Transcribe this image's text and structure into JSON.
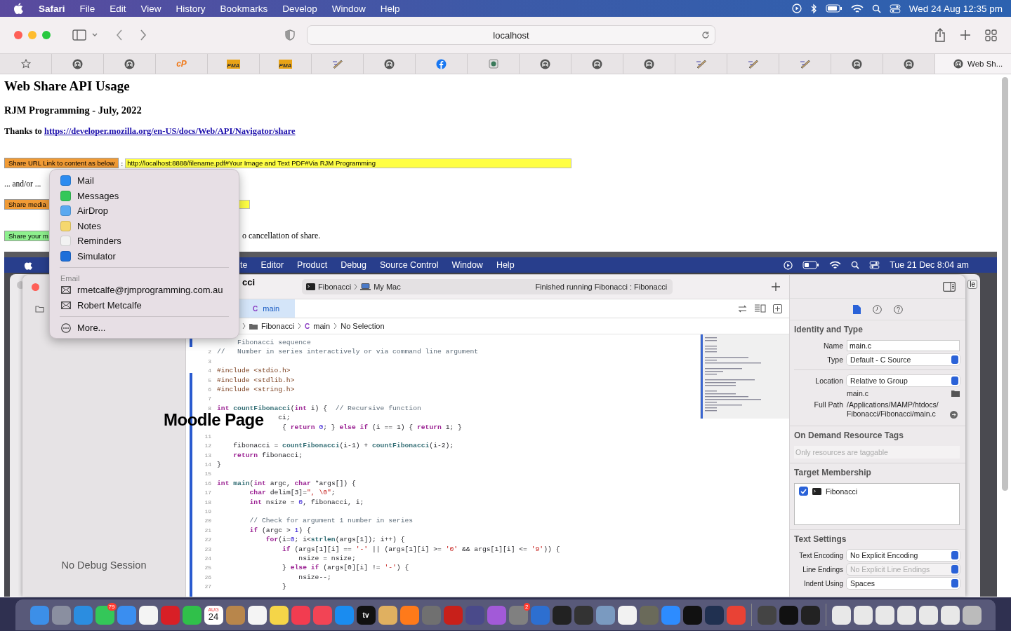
{
  "menu_bar": {
    "app": "Safari",
    "items": [
      "File",
      "Edit",
      "View",
      "History",
      "Bookmarks",
      "Develop",
      "Window",
      "Help"
    ],
    "clock": "Wed 24 Aug  12:35 pm"
  },
  "toolbar": {
    "address": "localhost"
  },
  "favorites_bar": {
    "icons": [
      {
        "kind": "elephant"
      },
      {
        "kind": "elephant"
      },
      {
        "kind": "text",
        "label": "cP"
      },
      {
        "kind": "pma",
        "label": "PMA"
      },
      {
        "kind": "pma",
        "label": "PMA"
      },
      {
        "kind": "pencil"
      },
      {
        "kind": "elephant"
      },
      {
        "kind": "facebook"
      },
      {
        "kind": "globe"
      },
      {
        "kind": "elephant"
      },
      {
        "kind": "elephant"
      },
      {
        "kind": "elephant"
      },
      {
        "kind": "pencil"
      },
      {
        "kind": "pencil"
      },
      {
        "kind": "pencil"
      },
      {
        "kind": "elephant"
      },
      {
        "kind": "elephant"
      }
    ],
    "tab_label": "Web Sh..."
  },
  "page": {
    "title": "Web Share API Usage",
    "subtitle": "RJM Programming - July, 2022",
    "thanks": "Thanks to",
    "link": "https://developer.mozilla.org/en-US/docs/Web/API/Navigator/share",
    "share_url": {
      "button": "Share URL Link to content as below",
      "separator": ":",
      "value": "http://localhost:8888/filename.pdf#Your Image and Text PDF#Via RJM Programming"
    },
    "and_or": "... and/or ...",
    "share_media": {
      "button": "Share media"
    },
    "share_your": {
      "button": "Share your m",
      "note": "o cancellation of share."
    }
  },
  "share_menu": {
    "apps": [
      {
        "kind": "mail",
        "label": "Mail"
      },
      {
        "kind": "messages",
        "label": "Messages"
      },
      {
        "kind": "airdrop",
        "label": "AirDrop"
      },
      {
        "kind": "notes",
        "label": "Notes"
      },
      {
        "kind": "reminders",
        "label": "Reminders"
      },
      {
        "kind": "simulator",
        "label": "Simulator"
      }
    ],
    "section": "Email",
    "contacts": [
      "rmetcalfe@rjmprogramming.com.au",
      "Robert Metcalfe"
    ],
    "more": "More..."
  },
  "screenshot": {
    "menu_bar": {
      "items": [
        "te",
        "Editor",
        "Product",
        "Debug",
        "Source Control",
        "Window",
        "Help"
      ],
      "clock": "Tue 21 Dec  8:04 am"
    },
    "behind_button": "le",
    "window_title": "cci",
    "scheme": {
      "target": "Fibonacci",
      "destination": "My Mac",
      "status": "Finished running Fibonacci : Fibonacci"
    },
    "tabs": [
      {
        "icon": "C",
        "label": "main",
        "selected": true
      }
    ],
    "jump_bar": [
      {
        "kind": "folder",
        "label": "Fibonacci"
      },
      {
        "kind": "c",
        "icon": "C",
        "label": "main"
      },
      {
        "kind": "plain",
        "label": "No Selection"
      }
    ],
    "navigator": {
      "status": "No Debug Session"
    },
    "overlay_text": "Moodle Page",
    "code": [
      {
        "seg": [
          {
            "kind": "comment",
            "text": "     Fibonacci sequence"
          }
        ]
      },
      {
        "n": "2",
        "seg": [
          {
            "kind": "comment",
            "text": "//   Number in series interactively or via command line argument"
          }
        ]
      },
      {
        "n": "3"
      },
      {
        "n": "4",
        "seg": [
          {
            "kind": "directive",
            "text": "#include <stdio.h>"
          }
        ]
      },
      {
        "n": "5",
        "seg": [
          {
            "kind": "directive",
            "text": "#include <stdlib.h>"
          }
        ]
      },
      {
        "n": "6",
        "seg": [
          {
            "kind": "directive",
            "text": "#include <string.h>"
          }
        ]
      },
      {
        "n": "7"
      },
      {
        "n": "8",
        "seg": [
          {
            "kind": "keyword",
            "text": "int"
          },
          {
            "kind": "function",
            "text": " countFibonacci"
          },
          {
            "kind": "plain",
            "text": "("
          },
          {
            "kind": "keyword",
            "text": "int"
          },
          {
            "kind": "plain",
            "text": " i) {  "
          },
          {
            "kind": "comment",
            "text": "// Recursive function"
          }
        ]
      },
      {
        "seg": [
          {
            "kind": "plain",
            "text": "               ci;"
          }
        ]
      },
      {
        "seg": [
          {
            "kind": "plain",
            "text": "                { "
          },
          {
            "kind": "keyword",
            "text": "return"
          },
          {
            "kind": "number",
            "text": " 0"
          },
          {
            "kind": "plain",
            "text": "; } "
          },
          {
            "kind": "keyword",
            "text": "else if"
          },
          {
            "kind": "plain",
            "text": " (i == 1) { "
          },
          {
            "kind": "keyword",
            "text": "return"
          },
          {
            "kind": "plain",
            "text": " 1; }"
          }
        ]
      },
      {
        "n": "11"
      },
      {
        "n": "12",
        "seg": [
          {
            "kind": "plain",
            "text": "    fibonacci = "
          },
          {
            "kind": "function",
            "text": "countFibonacci"
          },
          {
            "kind": "plain",
            "text": "(i-1) + "
          },
          {
            "kind": "function",
            "text": "countFibonacci"
          },
          {
            "kind": "plain",
            "text": "(i-2);"
          }
        ]
      },
      {
        "n": "13",
        "seg": [
          {
            "kind": "keyword",
            "text": "    return"
          },
          {
            "kind": "plain",
            "text": " fibonacci;"
          }
        ]
      },
      {
        "n": "14",
        "seg": [
          {
            "kind": "plain",
            "text": "}"
          }
        ]
      },
      {
        "n": "15"
      },
      {
        "n": "16",
        "seg": [
          {
            "kind": "keyword",
            "text": "int"
          },
          {
            "kind": "function",
            "text": " main"
          },
          {
            "kind": "plain",
            "text": "("
          },
          {
            "kind": "keyword",
            "text": "int"
          },
          {
            "kind": "plain",
            "text": " argc, "
          },
          {
            "kind": "keyword",
            "text": "char"
          },
          {
            "kind": "plain",
            "text": " *args[]) {"
          }
        ]
      },
      {
        "n": "17",
        "seg": [
          {
            "kind": "keyword",
            "text": "        char"
          },
          {
            "kind": "plain",
            "text": " delim[3]="
          },
          {
            "kind": "string",
            "text": "\", \\0\""
          },
          {
            "kind": "plain",
            "text": ";"
          }
        ]
      },
      {
        "n": "18",
        "seg": [
          {
            "kind": "keyword",
            "text": "        int"
          },
          {
            "kind": "plain",
            "text": " nsize = "
          },
          {
            "kind": "number",
            "text": "0"
          },
          {
            "kind": "plain",
            "text": ", fibonacci, i;"
          }
        ]
      },
      {
        "n": "19"
      },
      {
        "n": "20",
        "seg": [
          {
            "kind": "comment",
            "text": "        // Check for argument 1 number in series"
          }
        ]
      },
      {
        "n": "21",
        "seg": [
          {
            "kind": "keyword",
            "text": "        if"
          },
          {
            "kind": "plain",
            "text": " (argc > "
          },
          {
            "kind": "number",
            "text": "1"
          },
          {
            "kind": "plain",
            "text": ") {"
          }
        ]
      },
      {
        "n": "22",
        "seg": [
          {
            "kind": "keyword",
            "text": "            for"
          },
          {
            "kind": "plain",
            "text": "(i="
          },
          {
            "kind": "number",
            "text": "0"
          },
          {
            "kind": "plain",
            "text": "; i<"
          },
          {
            "kind": "function",
            "text": "strlen"
          },
          {
            "kind": "plain",
            "text": "(args[1]); i++) {"
          }
        ]
      },
      {
        "n": "23",
        "seg": [
          {
            "kind": "keyword",
            "text": "                if"
          },
          {
            "kind": "plain",
            "text": " (args[1][i] == "
          },
          {
            "kind": "string",
            "text": "'-'"
          },
          {
            "kind": "plain",
            "text": " || (args[1][i] >= "
          },
          {
            "kind": "string",
            "text": "'0'"
          },
          {
            "kind": "plain",
            "text": " && args[1][i] <= "
          },
          {
            "kind": "string",
            "text": "'9'"
          },
          {
            "kind": "plain",
            "text": ")) {"
          }
        ]
      },
      {
        "n": "24",
        "seg": [
          {
            "kind": "plain",
            "text": "                    nsize = nsize;"
          }
        ]
      },
      {
        "n": "25",
        "seg": [
          {
            "kind": "plain",
            "text": "                } "
          },
          {
            "kind": "keyword",
            "text": "else if"
          },
          {
            "kind": "plain",
            "text": " (args[0][i] != "
          },
          {
            "kind": "string",
            "text": "'-'"
          },
          {
            "kind": "plain",
            "text": ") {"
          }
        ]
      },
      {
        "n": "26",
        "seg": [
          {
            "kind": "plain",
            "text": "                    nsize--;"
          }
        ]
      },
      {
        "n": "27",
        "seg": [
          {
            "kind": "plain",
            "text": "                }"
          }
        ]
      }
    ],
    "inspector": {
      "identity": {
        "heading": "Identity and Type",
        "name_label": "Name",
        "name_value": "main.c",
        "type_label": "Type",
        "type_value": "Default - C Source",
        "location_label": "Location",
        "location_value": "Relative to Group",
        "file": "main.c",
        "path_label": "Full Path",
        "path": [
          "/Applications/MAMP/htdocs/",
          "Fibonacci/Fibonacci/main.c"
        ]
      },
      "tags": {
        "heading": "On Demand Resource Tags",
        "placeholder": "Only resources are taggable"
      },
      "membership": {
        "heading": "Target Membership",
        "targets": [
          {
            "label": "Fibonacci",
            "checked": true
          }
        ]
      },
      "text_settings": {
        "heading": "Text Settings",
        "rows": [
          {
            "label": "Text Encoding",
            "value": "No Explicit Encoding",
            "disabled": false
          },
          {
            "label": "Line Endings",
            "value": "No Explicit Line Endings",
            "disabled": true
          },
          {
            "label": "Indent Using",
            "value": "Spaces",
            "disabled": false
          }
        ]
      }
    }
  },
  "dock": {
    "messages_badge": "79",
    "calendar_month": "AUG",
    "calendar_day": "24",
    "tv_label": "tv",
    "settings_badge": "2"
  }
}
